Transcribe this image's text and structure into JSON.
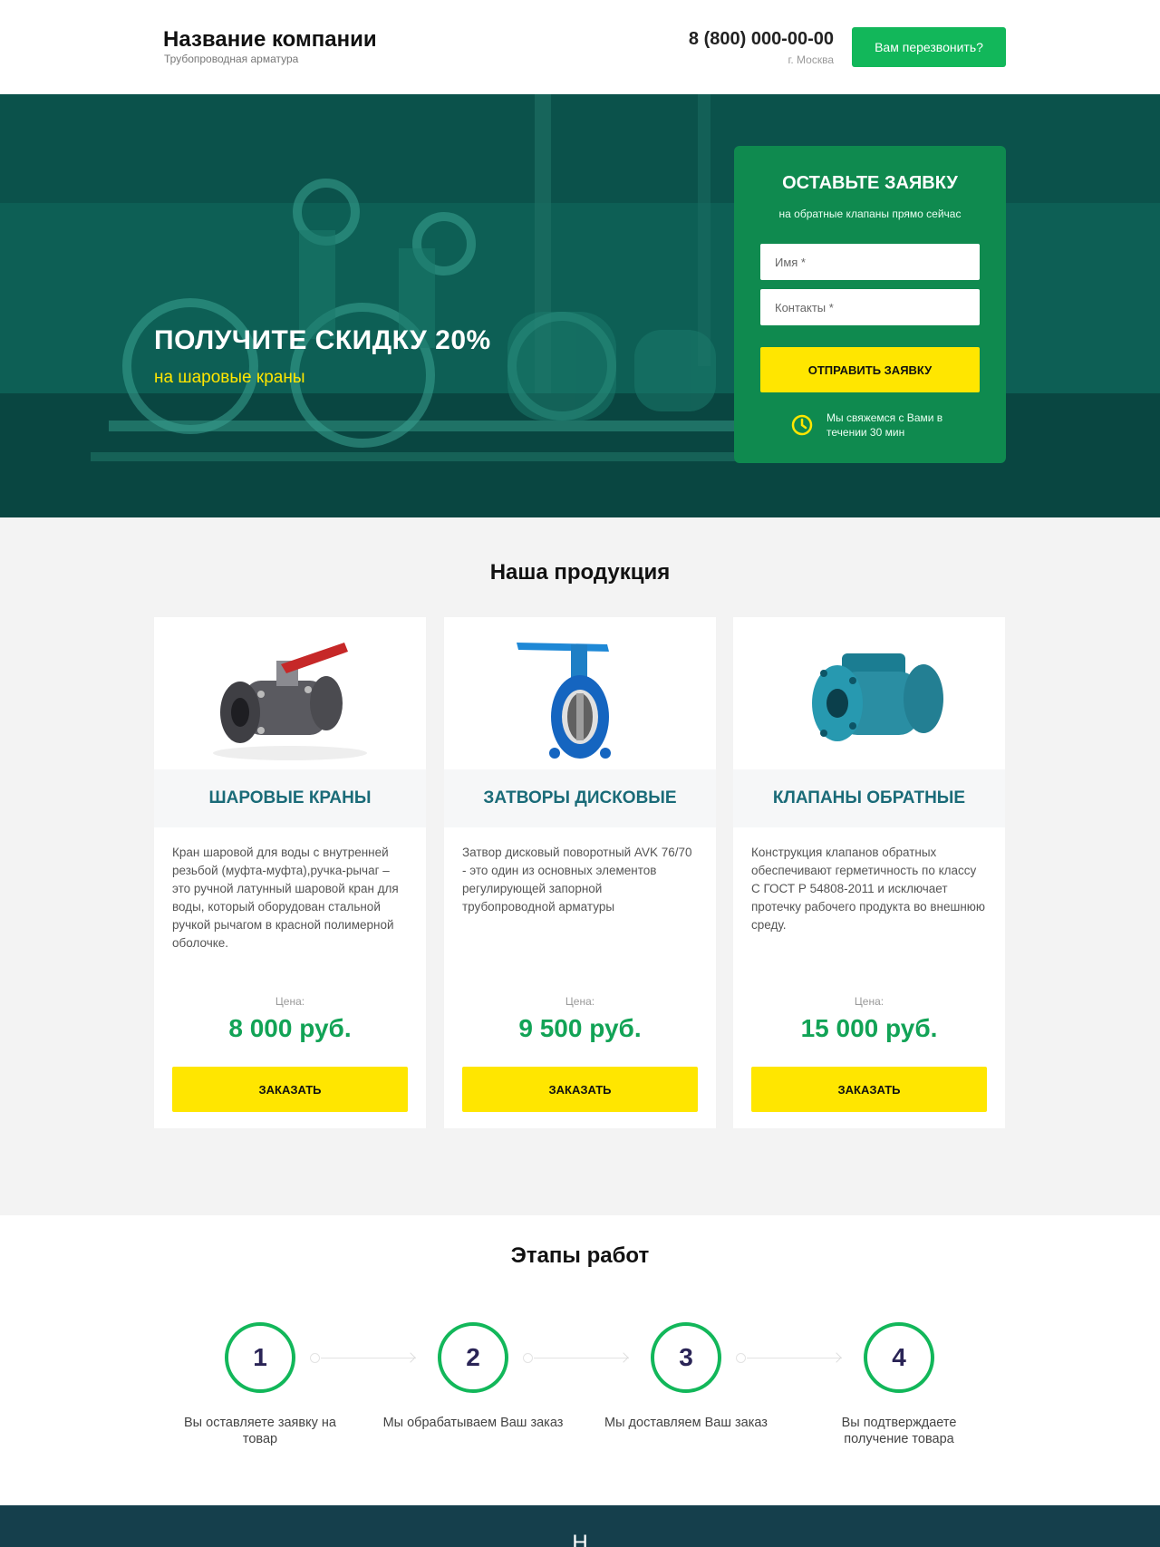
{
  "header": {
    "company_name": "Название компании",
    "company_tagline": "Трубопроводная арматура",
    "phone": "8 (800) 000-00-00",
    "city": "г. Москва",
    "callback_label": "Вам перезвонить?"
  },
  "hero": {
    "title": "ПОЛУЧИТЕ СКИДКУ 20%",
    "subtitle": "на шаровые краны",
    "form": {
      "title": "ОСТАВЬТЕ ЗАЯВКУ",
      "subtitle": "на обратные клапаны прямо сейчас",
      "name_placeholder": "Имя *",
      "contact_placeholder": "Контакты *",
      "submit_label": "ОТПРАВИТЬ ЗАЯВКУ",
      "note": "Мы свяжемся с Вами в течении 30 мин",
      "note_icon": "clock-icon"
    }
  },
  "products": {
    "title": "Наша продукция",
    "price_label": "Цена:",
    "order_label": "ЗАКАЗАТЬ",
    "items": [
      {
        "name": "ШАРОВЫЕ КРАНЫ",
        "description": "Кран шаровой для воды с внутренней резьбой (муфта-муфта),ручка-рычаг – это ручной латунный шаровой кран для воды, который оборудован стальной ручкой рычагом в красной полимерной оболочке.",
        "price": "8 000 руб.",
        "image": "ball-valve-image"
      },
      {
        "name": "ЗАТВОРЫ ДИСКОВЫЕ",
        "description": "Затвор дисковый поворотный AVK 76/70 - это один из основных элементов регулирующей запорной трубопроводной арматуры",
        "price": "9 500 руб.",
        "image": "butterfly-valve-image"
      },
      {
        "name": "КЛАПАНЫ ОБРАТНЫЕ",
        "description": "Конструкция клапанов обратных обеспечивают герметичность по классу С ГОСТ Р 54808-2011 и исключает протечку рабочего продукта во внешнюю среду.",
        "price": "15 000 руб.",
        "image": "check-valve-image"
      }
    ]
  },
  "steps": {
    "title": "Этапы работ",
    "items": [
      {
        "number": "1",
        "text": "Вы оставляете заявку на товар"
      },
      {
        "number": "2",
        "text": "Мы обрабатываем Ваш заказ"
      },
      {
        "number": "3",
        "text": "Мы доставляем Ваш заказ"
      },
      {
        "number": "4",
        "text": "Вы подтверждаете получение товара"
      }
    ]
  },
  "footer": {
    "title_partial": "Н"
  },
  "colors": {
    "accent_green": "#12b75a",
    "form_green": "#0f8a4f",
    "yellow": "#ffe600",
    "hero_teal": "#0d6b5d",
    "product_title": "#1a6b78",
    "price_green": "#12a356",
    "footer_dark": "#153f4c"
  }
}
